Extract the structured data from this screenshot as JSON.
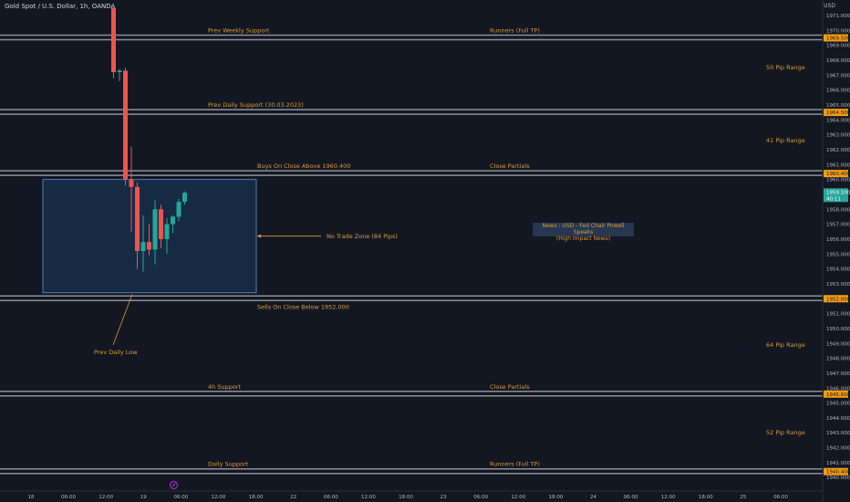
{
  "header": {
    "symbol_title": "Gold Spot / U.S. Dollar, 1h, OANDA",
    "currency": "USD"
  },
  "colors": {
    "background": "#131722",
    "annotation": "#d99b3a",
    "bull": "#26a69a",
    "bear": "#ef5350",
    "level_line": "#8c8f99",
    "zone_fill": "#1c3a5e",
    "zone_border": "#4f7fb8",
    "axis_text": "#b2b5be",
    "price_tag_bg": "#f39c12",
    "last_price_bg": "#26a69a"
  },
  "chart_data": {
    "type": "candlestick",
    "y_range": [
      1939.0,
      1971.5
    ],
    "y_ticks": [
      "1971.000",
      "1970.000",
      "1969.000",
      "1968.000",
      "1967.000",
      "1966.000",
      "1965.000",
      "1964.000",
      "1963.000",
      "1962.000",
      "1961.000",
      "1960.000",
      "1958.000",
      "1957.000",
      "1956.000",
      "1955.000",
      "1954.000",
      "1953.000",
      "1951.000",
      "1950.000",
      "1949.000",
      "1948.000",
      "1947.000",
      "1946.000",
      "1945.000",
      "1944.000",
      "1943.000",
      "1942.000",
      "1941.000",
      "1940.000",
      "1939.000"
    ],
    "x_ticks": [
      "18",
      "06:00",
      "12:00",
      "19",
      "06:00",
      "12:00",
      "18:00",
      "22",
      "06:00",
      "12:00",
      "18:00",
      "23",
      "06:00",
      "12:00",
      "18:00",
      "24",
      "06:00",
      "12:00",
      "18:00",
      "25",
      "06:00"
    ],
    "candles": [
      {
        "o": 1971.5,
        "h": 1971.5,
        "l": 1966.8,
        "c": 1967.2
      },
      {
        "o": 1967.2,
        "h": 1967.4,
        "l": 1966.6,
        "c": 1967.3
      },
      {
        "o": 1967.3,
        "h": 1967.5,
        "l": 1959.6,
        "c": 1960.0
      },
      {
        "o": 1960.0,
        "h": 1962.2,
        "l": 1956.5,
        "c": 1959.5
      },
      {
        "o": 1959.5,
        "h": 1959.8,
        "l": 1954.0,
        "c": 1955.2
      },
      {
        "o": 1955.2,
        "h": 1957.6,
        "l": 1953.8,
        "c": 1955.8
      },
      {
        "o": 1955.8,
        "h": 1957.0,
        "l": 1954.9,
        "c": 1955.3
      },
      {
        "o": 1955.3,
        "h": 1958.6,
        "l": 1954.3,
        "c": 1958.0
      },
      {
        "o": 1958.0,
        "h": 1958.3,
        "l": 1955.4,
        "c": 1956.0
      },
      {
        "o": 1956.0,
        "h": 1957.4,
        "l": 1955.0,
        "c": 1957.0
      },
      {
        "o": 1957.0,
        "h": 1957.6,
        "l": 1956.4,
        "c": 1957.5
      },
      {
        "o": 1957.5,
        "h": 1958.7,
        "l": 1957.2,
        "c": 1958.5
      },
      {
        "o": 1958.5,
        "h": 1959.2,
        "l": 1958.3,
        "c": 1959.1
      }
    ],
    "levels": [
      {
        "price": 1969.5,
        "tag": "1969.500",
        "label": "Prev Weekly Support",
        "label2": "Runners (Full TP)"
      },
      {
        "price": 1964.5,
        "tag": "1964.500",
        "label": "Prev Daily Support (30.03.2023)",
        "label2": ""
      },
      {
        "price": 1960.4,
        "tag": "1960.400",
        "label": "Buys On Close Above 1960.400",
        "label2": "Close Partials"
      },
      {
        "price": 1952.0,
        "tag": "1952.000",
        "label": "Sells On Close Below 1952.000",
        "label2": ""
      },
      {
        "price": 1945.6,
        "tag": "1945.600",
        "label": "4h Support",
        "label2": "Close Partials"
      },
      {
        "price": 1940.4,
        "tag": "1940.400",
        "label": "Daily Support",
        "label2": "Runners (Full TP)"
      }
    ],
    "range_labels": [
      {
        "price": 1967.5,
        "text": "50 Pip Range"
      },
      {
        "price": 1962.6,
        "text": "41 Pip Range"
      },
      {
        "price": 1948.9,
        "text": "64 Pip Range"
      },
      {
        "price": 1943.0,
        "text": "52 Pip Range"
      }
    ],
    "last_price": {
      "value": "1959.100",
      "countdown": "40:11"
    },
    "no_trade_zone": {
      "top": 1960.0,
      "bottom": 1952.4,
      "label": "No Trade Zone (84 Pips)"
    },
    "prev_daily_low": {
      "price": 1952.3,
      "label": "Prev Daily Low"
    }
  },
  "news": {
    "line1": "News : USD - Fed Chair Powell Speaks",
    "line2": "(High Impact News)"
  }
}
